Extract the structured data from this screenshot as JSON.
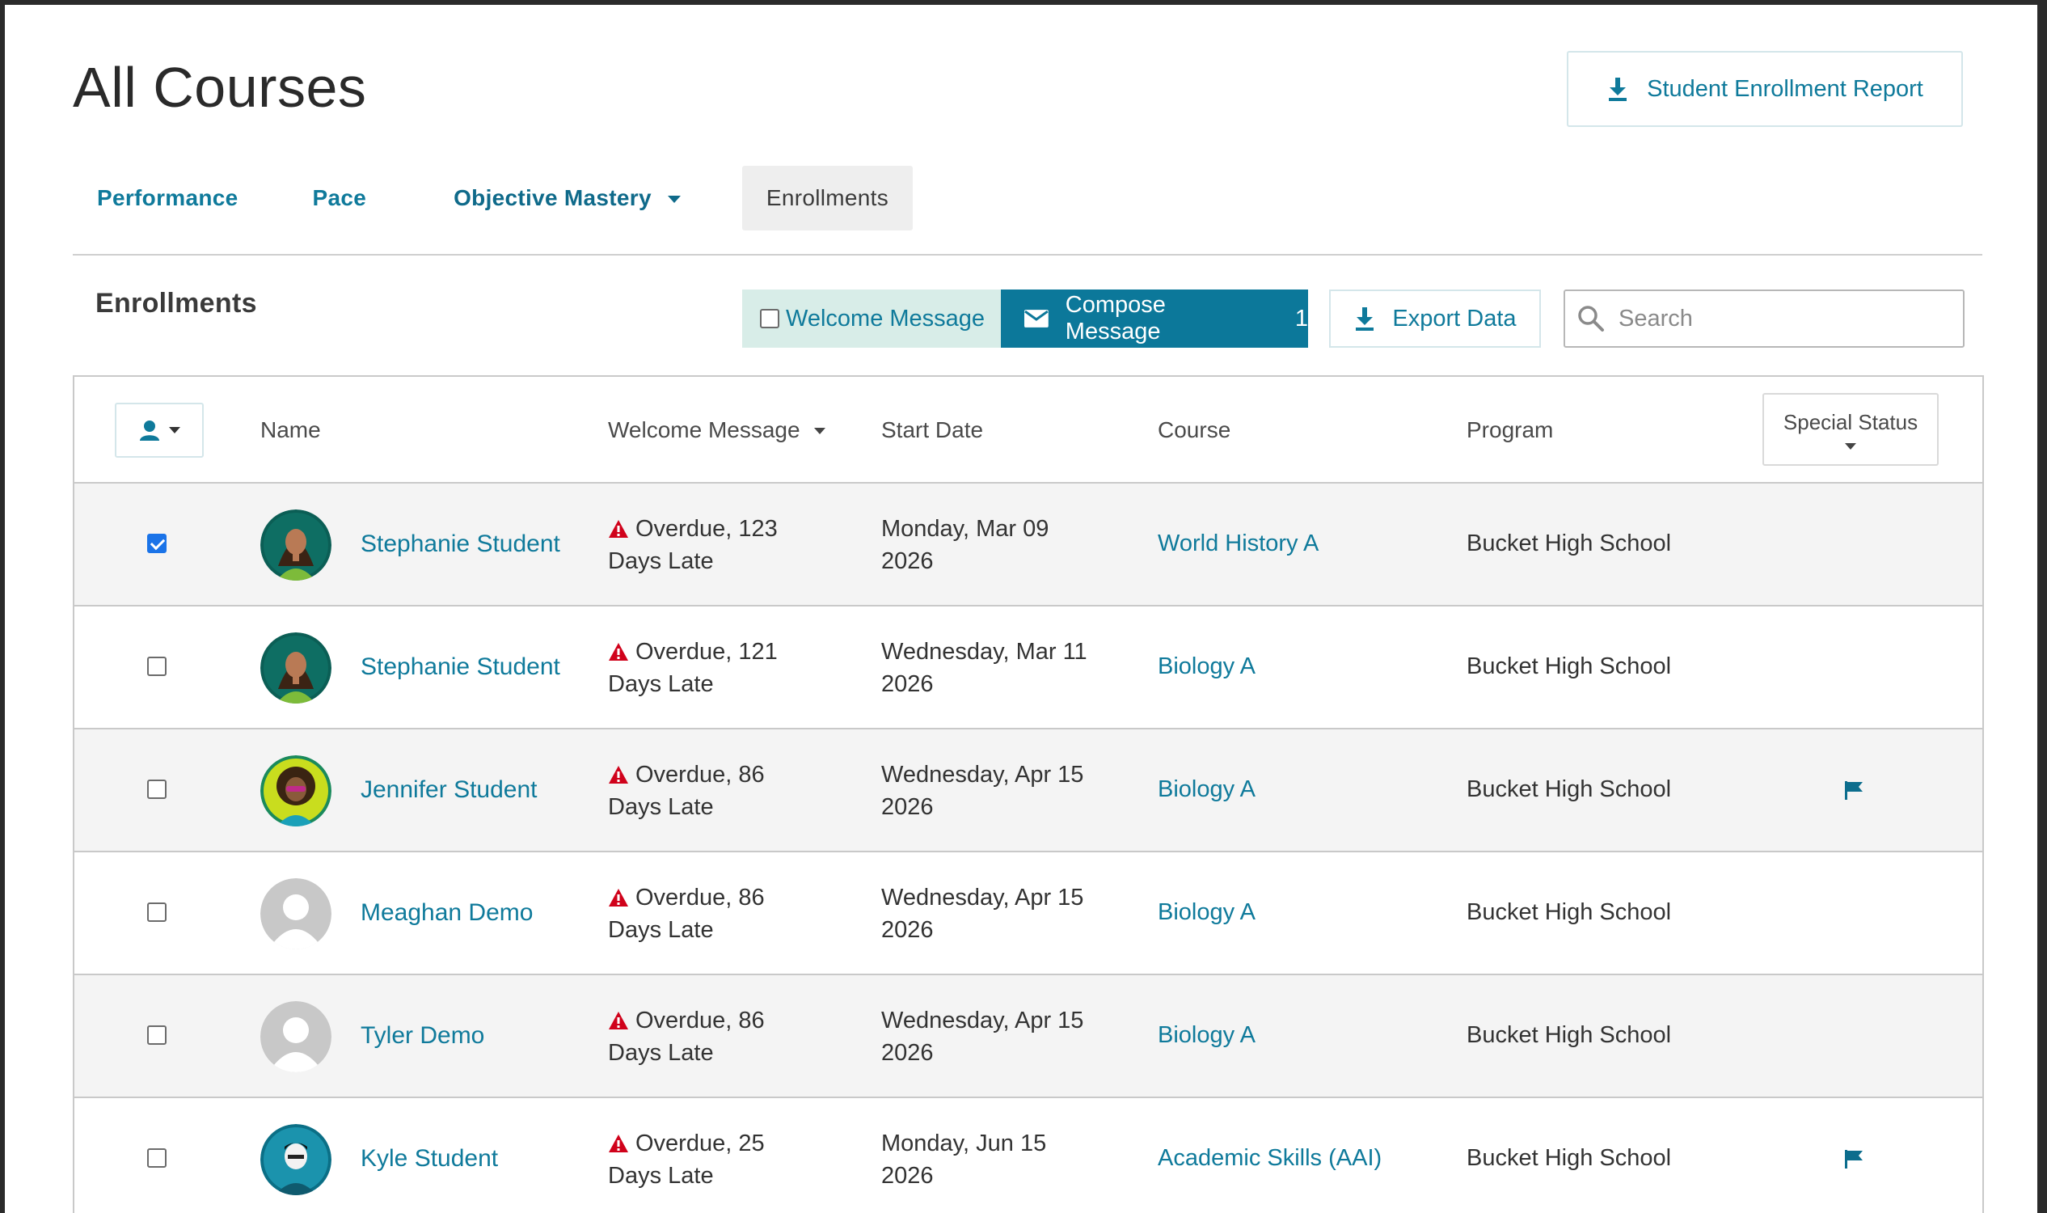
{
  "header": {
    "title": "All Courses",
    "report_button": "Student Enrollment Report"
  },
  "tabs": [
    {
      "label": "Performance"
    },
    {
      "label": "Pace"
    },
    {
      "label": "Objective Mastery"
    },
    {
      "label": "Enrollments"
    }
  ],
  "section": {
    "title": "Enrollments",
    "welcome_toggle": "Welcome Message",
    "compose_button": "Compose Message",
    "compose_count": "1",
    "export_button": "Export Data",
    "search_placeholder": "Search"
  },
  "table": {
    "columns": {
      "name": "Name",
      "welcome": "Welcome Message",
      "start": "Start Date",
      "course": "Course",
      "program": "Program",
      "special": "Special Status"
    },
    "rows": [
      {
        "checked": true,
        "name": "Stephanie Student",
        "welcome_line1": "Overdue, 123",
        "welcome_line2": "Days Late",
        "start_line1": "Monday, Mar 09",
        "start_line2": "2026",
        "course": "World History A",
        "program": "Bucket High School",
        "flag": false,
        "avatar": "stephanie-avatar"
      },
      {
        "checked": false,
        "name": "Stephanie Student",
        "welcome_line1": "Overdue, 121",
        "welcome_line2": "Days Late",
        "start_line1": "Wednesday, Mar 11",
        "start_line2": "2026",
        "course": "Biology A",
        "program": "Bucket High School",
        "flag": false,
        "avatar": "stephanie-avatar"
      },
      {
        "checked": false,
        "name": "Jennifer Student",
        "welcome_line1": "Overdue, 86",
        "welcome_line2": "Days Late",
        "start_line1": "Wednesday, Apr 15",
        "start_line2": "2026",
        "course": "Biology A",
        "program": "Bucket High School",
        "flag": true,
        "avatar": "jennifer-avatar"
      },
      {
        "checked": false,
        "name": "Meaghan Demo",
        "welcome_line1": "Overdue, 86",
        "welcome_line2": "Days Late",
        "start_line1": "Wednesday, Apr 15",
        "start_line2": "2026",
        "course": "Biology A",
        "program": "Bucket High School",
        "flag": false,
        "avatar": "default-avatar"
      },
      {
        "checked": false,
        "name": "Tyler Demo",
        "welcome_line1": "Overdue, 86",
        "welcome_line2": "Days Late",
        "start_line1": "Wednesday, Apr 15",
        "start_line2": "2026",
        "course": "Biology A",
        "program": "Bucket High School",
        "flag": false,
        "avatar": "default-avatar"
      },
      {
        "checked": false,
        "name": "Kyle Student",
        "welcome_line1": "Overdue, 25",
        "welcome_line2": "Days Late",
        "start_line1": "Monday, Jun 15",
        "start_line2": "2026",
        "course": "Academic Skills (AAI)",
        "program": "Bucket High School",
        "flag": true,
        "avatar": "kyle-avatar"
      }
    ]
  },
  "colors": {
    "accent": "#0f7a9b",
    "compose_bg": "#0c789a",
    "welcome_bg": "#d8ede8",
    "warning": "#d0021b",
    "row_alt": "#f4f4f4"
  }
}
